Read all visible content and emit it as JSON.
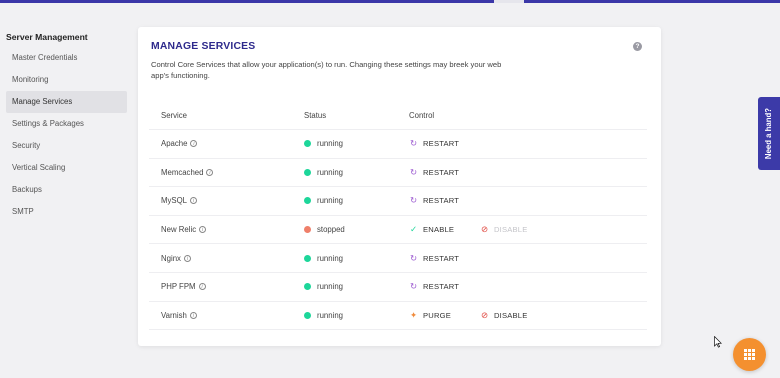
{
  "sidebar": {
    "heading": "Server Management",
    "items": [
      {
        "label": "Master Credentials"
      },
      {
        "label": "Monitoring"
      },
      {
        "label": "Manage Services",
        "active": true
      },
      {
        "label": "Settings & Packages"
      },
      {
        "label": "Security"
      },
      {
        "label": "Vertical Scaling"
      },
      {
        "label": "Backups"
      },
      {
        "label": "SMTP"
      }
    ]
  },
  "card": {
    "title": "MANAGE SERVICES",
    "help_icon": "question-icon",
    "description": "Control Core Services that allow your application(s) to run. Changing these settings may breek your web app's functioning."
  },
  "table": {
    "headers": {
      "service": "Service",
      "status": "Status",
      "control": "Control"
    },
    "rows": [
      {
        "service": "Apache",
        "status": "running",
        "action1": "RESTART",
        "action2": ""
      },
      {
        "service": "Memcached",
        "status": "running",
        "action1": "RESTART",
        "action2": ""
      },
      {
        "service": "MySQL",
        "status": "running",
        "action1": "RESTART",
        "action2": ""
      },
      {
        "service": "New Relic",
        "status": "stopped",
        "action1": "ENABLE",
        "action2": "DISABLE"
      },
      {
        "service": "Nginx",
        "status": "running",
        "action1": "RESTART",
        "action2": ""
      },
      {
        "service": "PHP FPM",
        "status": "running",
        "action1": "RESTART",
        "action2": ""
      },
      {
        "service": "Varnish",
        "status": "running",
        "action1": "PURGE",
        "action2": "DISABLE"
      }
    ]
  },
  "colors": {
    "running": "#1dd69a",
    "stopped": "#ef7f6a",
    "accent": "#2e2a8c",
    "restart_icon": "#9b59d0",
    "enable_icon": "#1dd69a",
    "purge_icon": "#f08a3a",
    "disable_icon": "#e0463e",
    "fab": "#f4902f"
  },
  "help_tab": {
    "label": "Need a hand?"
  },
  "fab": {
    "icon": "grid-icon"
  }
}
